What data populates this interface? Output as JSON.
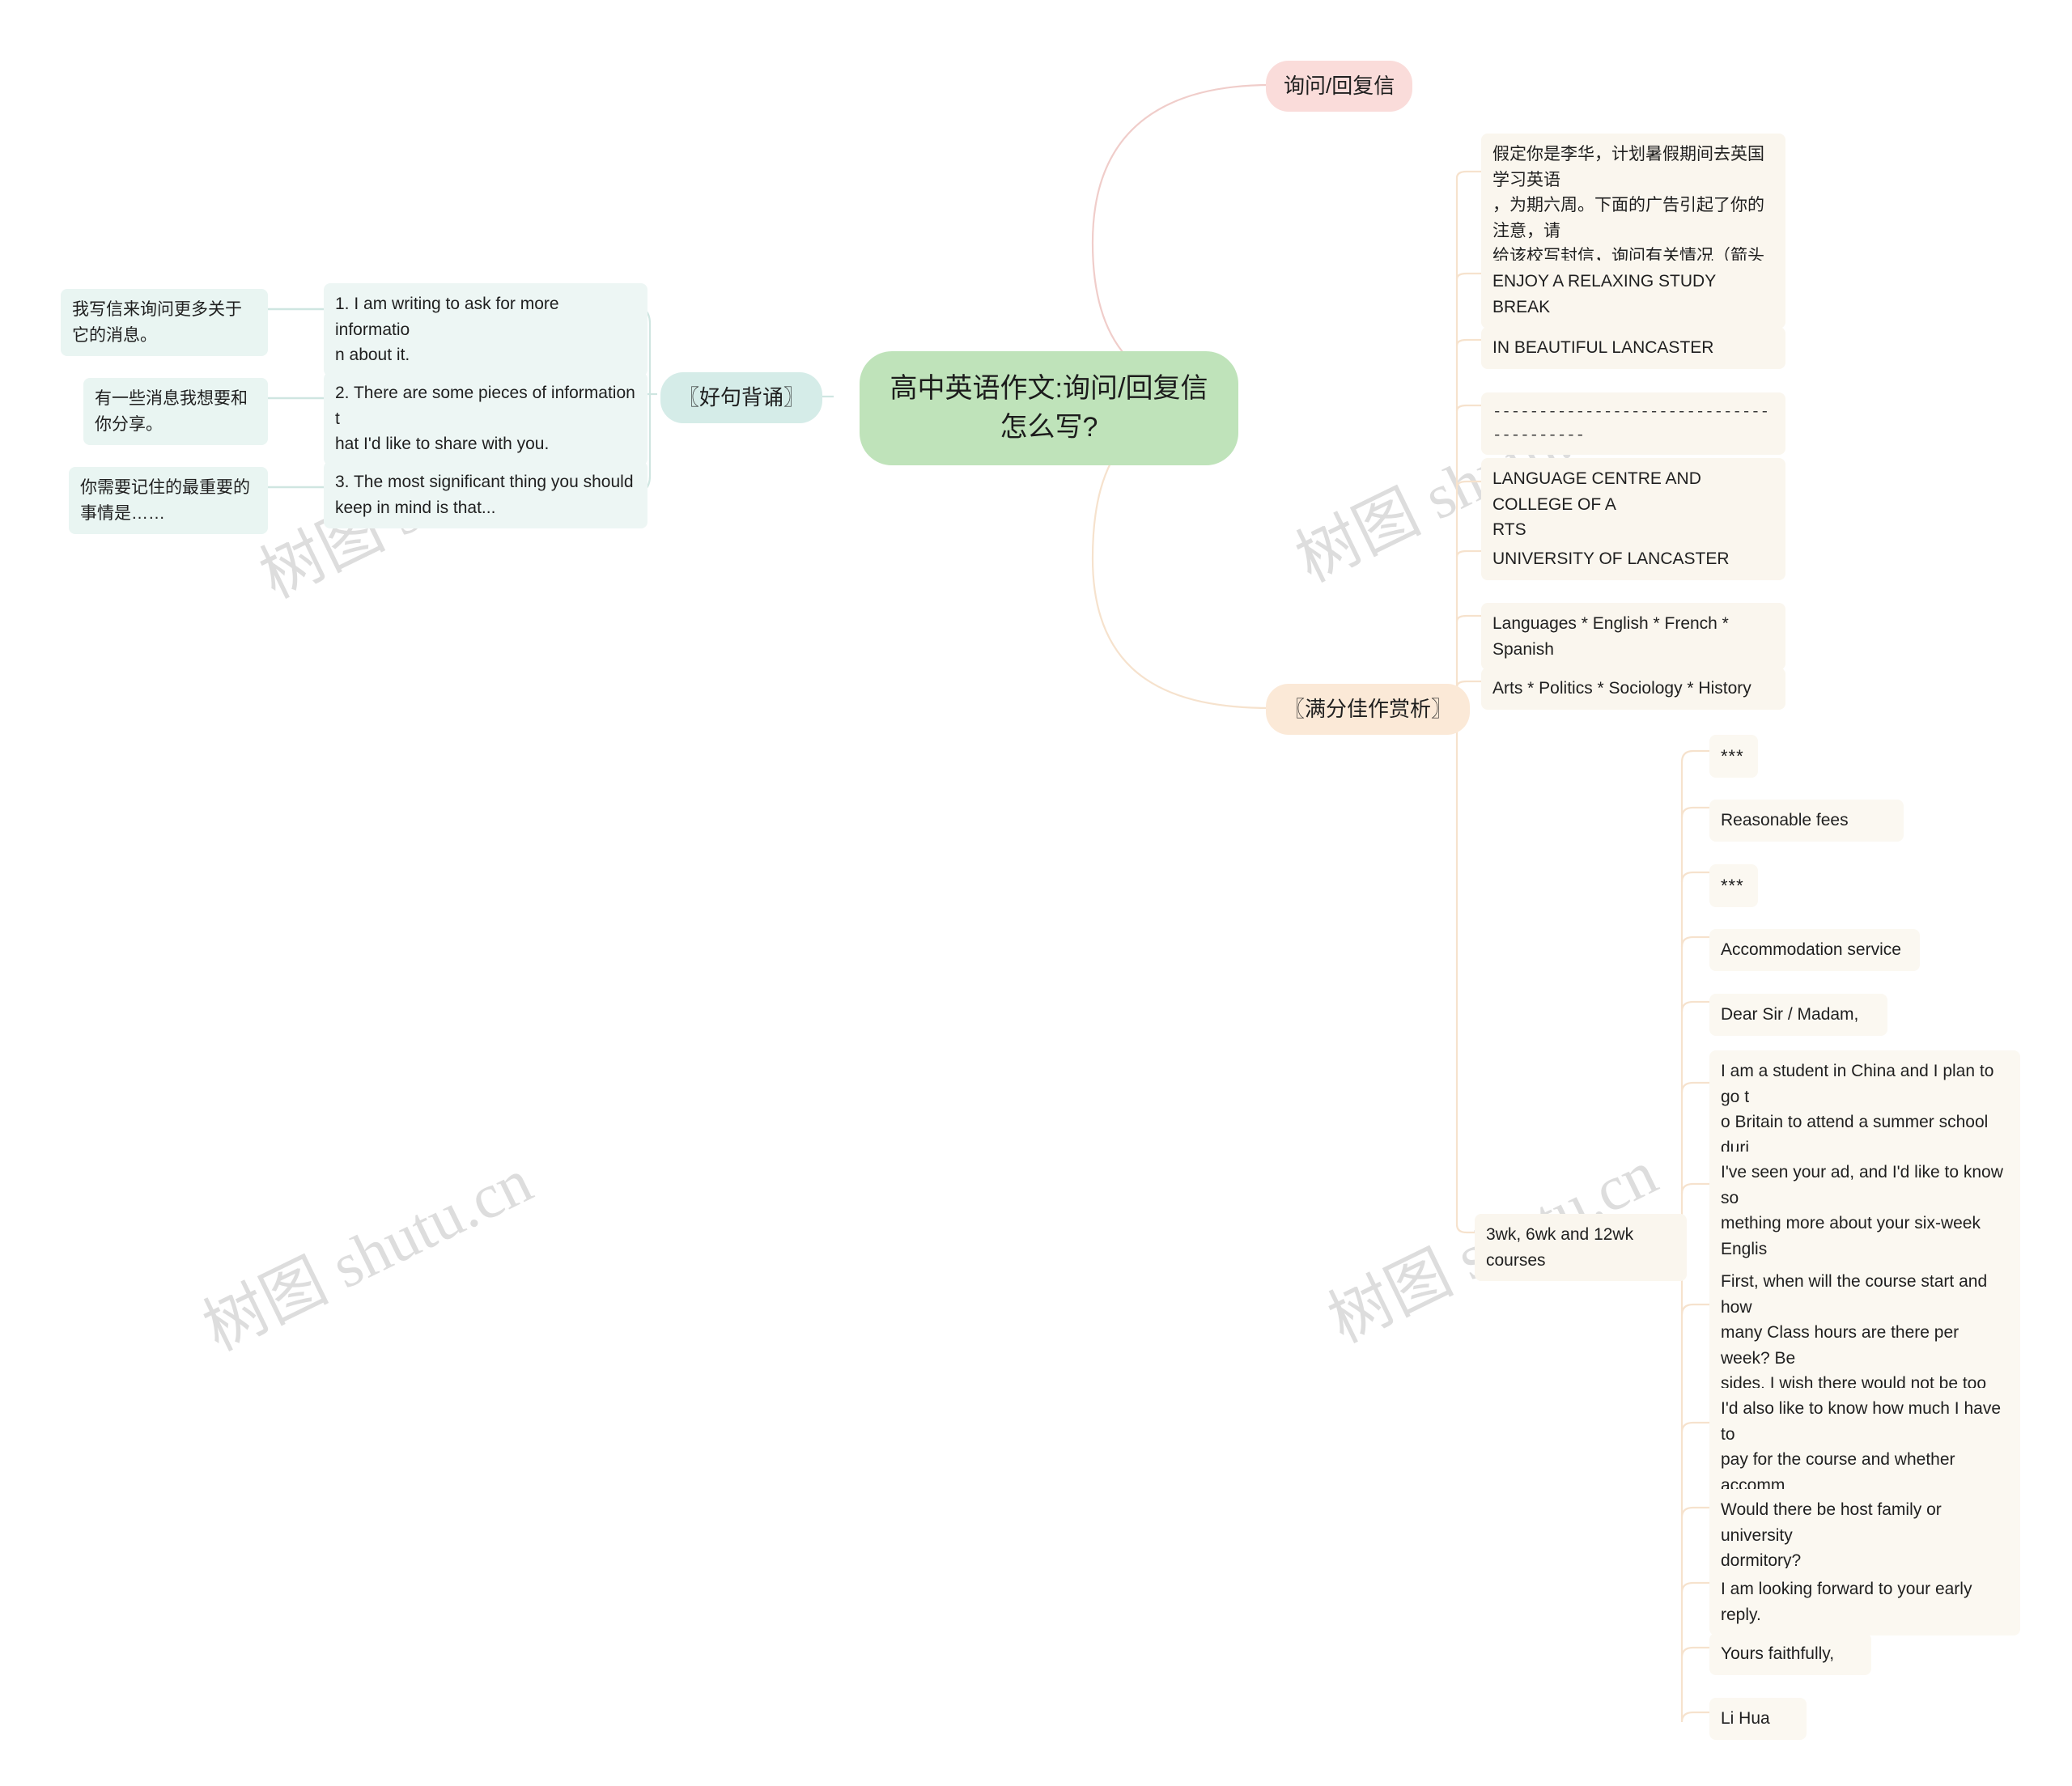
{
  "watermark": {
    "text": "树图 shutu.cn"
  },
  "central": {
    "label": "高中英语作文:询问/回复信\n怎么写?"
  },
  "branches": {
    "inquiry_reply": {
      "label": "询问/回复信"
    },
    "good_sentences": {
      "label": "〖好句背诵〗"
    },
    "model_essay": {
      "label": "〖满分佳作赏析〗"
    }
  },
  "good_sentences_items": [
    {
      "chinese": "我写信来询问更多关于它的消息。",
      "english": "1. I am writing to ask for more informatio\nn about it."
    },
    {
      "chinese": "有一些消息我想要和你分享。",
      "english": "2. There are some pieces of information t\nhat I'd like to share with you."
    },
    {
      "chinese": "你需要记住的最重要的事情是……",
      "english": "3. The most significant thing you should\nkeep in mind is that..."
    }
  ],
  "model_essay_items": [
    {
      "text": "假定你是李华，计划暑假期间去英国学习英语\n，为期六周。下面的广告引起了你的注意，请\n给该校写封信，询问有关情况（箭头所指内容\n）。"
    },
    {
      "text": "ENJOY A RELAXING STUDY BREAK"
    },
    {
      "text": "IN BEAUTIFUL LANCASTER"
    },
    {
      "text": "----------------------------------------",
      "style": "dashes"
    },
    {
      "text": "LANGUAGE CENTRE AND COLLEGE OF A\nRTS"
    },
    {
      "text": "UNIVERSITY OF LANCASTER"
    },
    {
      "text": "Languages * English * French * Spanish"
    },
    {
      "text": "Arts * Politics * Sociology * History"
    },
    {
      "text": "3wk, 6wk and 12wk courses"
    }
  ],
  "courses_children": [
    {
      "text": "***",
      "style": "stars"
    },
    {
      "text": "Reasonable fees"
    },
    {
      "text": "***",
      "style": "stars"
    },
    {
      "text": "Accommodation service"
    },
    {
      "text": "Dear Sir / Madam,"
    },
    {
      "text": "I am a student in China and I plan to go t\no Britain to attend a summer school duri\nng the vacation."
    },
    {
      "text": "I've seen your ad, and I'd like to know so\nmething more about your six-week Englis\nh courses."
    },
    {
      "text": "First, when will the course start and how\nmany Class hours are there per week? Be\nsides, I wish there would not be too many\n students in a class."
    },
    {
      "text": "I'd also like to know how much I have to\npay for the course and whether accomm\nodation is included."
    },
    {
      "text": "Would there be host family or university\ndormitory?"
    },
    {
      "text": "I am looking forward to your early reply."
    },
    {
      "text": "Yours faithfully,"
    },
    {
      "text": "Li Hua"
    }
  ],
  "colors": {
    "central_bg": "#bfe3ba",
    "pink": "#fadcda",
    "mint": "#d5ece8",
    "orange": "#fbe9d7",
    "link_pink": "#f0cdca",
    "link_mint": "#cfe6e1",
    "link_orange": "#f6e2cd"
  }
}
